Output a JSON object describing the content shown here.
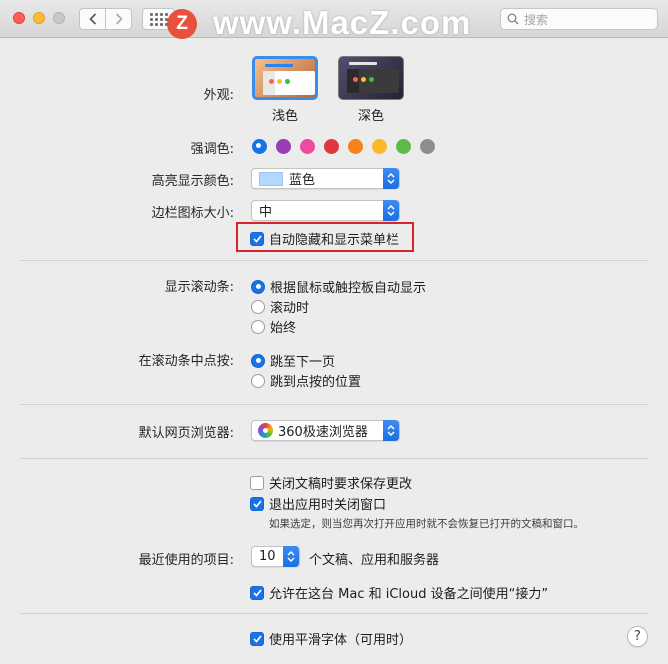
{
  "watermark": {
    "badge": "Z",
    "text": "www.MacZ.com"
  },
  "search": {
    "placeholder": "搜索"
  },
  "appearance": {
    "label": "外观:",
    "options": [
      {
        "name": "浅色",
        "selected": true
      },
      {
        "name": "深色",
        "selected": false
      }
    ]
  },
  "accent": {
    "label": "强调色:",
    "colors": [
      "#1873e8",
      "#9a3cb5",
      "#f04a9f",
      "#e0383e",
      "#f7821b",
      "#fcb827",
      "#5fb946",
      "#8e8e8e"
    ],
    "selected_index": 0
  },
  "highlight": {
    "label": "高亮显示颜色:",
    "value": "蓝色",
    "swatch": "#b3d7ff"
  },
  "sidebar_icon": {
    "label": "边栏图标大小:",
    "value": "中"
  },
  "auto_hide_menu": {
    "label": "自动隐藏和显示菜单栏",
    "checked": true
  },
  "show_scrollbars": {
    "label": "显示滚动条:",
    "options": [
      {
        "text": "根据鼠标或触控板自动显示",
        "selected": true
      },
      {
        "text": "滚动时",
        "selected": false
      },
      {
        "text": "始终",
        "selected": false
      }
    ]
  },
  "click_scrollbar": {
    "label": "在滚动条中点按:",
    "options": [
      {
        "text": "跳至下一页",
        "selected": true
      },
      {
        "text": "跳到点按的位置",
        "selected": false
      }
    ]
  },
  "default_browser": {
    "label": "默认网页浏览器:",
    "value": "360极速浏览器"
  },
  "ask_keep_changes": {
    "label": "关闭文稿时要求保存更改",
    "checked": false
  },
  "close_windows": {
    "label": "退出应用时关闭窗口",
    "checked": true
  },
  "close_windows_note": "如果选定，则当您再次打开应用时就不会恢复已打开的文稿和窗口。",
  "recent_items": {
    "label": "最近使用的项目:",
    "value": "10",
    "suffix": "个文稿、应用和服务器"
  },
  "handoff": {
    "label": "允许在这台 Mac 和 iCloud 设备之间使用“接力”",
    "checked": true
  },
  "font_smoothing": {
    "label": "使用平滑字体（可用时）",
    "checked": true
  },
  "help": "?"
}
